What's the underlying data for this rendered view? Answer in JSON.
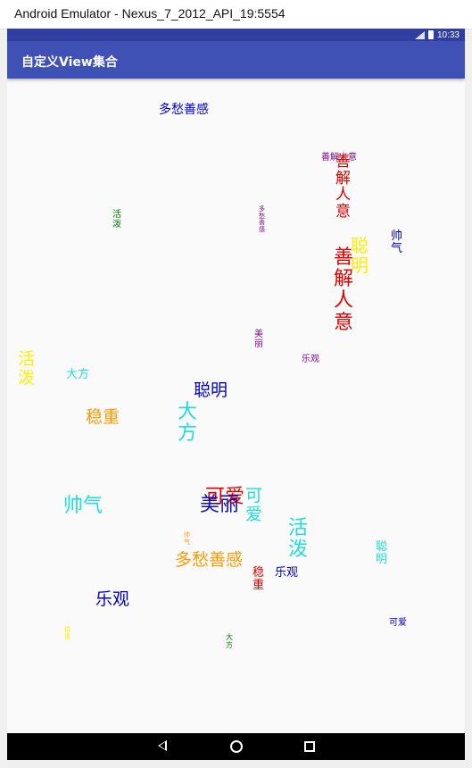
{
  "window": {
    "title": "Android Emulator - Nexus_7_2012_API_19:5554"
  },
  "statusbar": {
    "time": "10:33",
    "battery_icon": "battery-icon",
    "signal_icon": "signal-icon"
  },
  "appbar": {
    "title": "自定义View集合"
  },
  "navbar": {
    "back_icon": "back-triangle-icon",
    "home_icon": "home-circle-icon",
    "recent_icon": "recents-square-icon"
  },
  "words": [
    {
      "text": "多愁善感",
      "color": "#0000cc"
    },
    {
      "text": "善解人意",
      "color": "#7b0a8a"
    },
    {
      "text": "善解人意",
      "color": "#e00000"
    },
    {
      "text": "活泼",
      "color": "#007700"
    },
    {
      "text": "多愁善感",
      "color": "#7b0a8a"
    },
    {
      "text": "帅气",
      "color": "#0000cc"
    },
    {
      "text": "聪明",
      "color": "#ffee00"
    },
    {
      "text": "善解人意",
      "color": "#e00000"
    },
    {
      "text": "美丽",
      "color": "#7b0a8a"
    },
    {
      "text": "乐观",
      "color": "#7b0a8a"
    },
    {
      "text": "活泼",
      "color": "#ffee00"
    },
    {
      "text": "大方",
      "color": "#22dddd"
    },
    {
      "text": "聪明",
      "color": "#0000cc"
    },
    {
      "text": "稳重",
      "color": "#ff9900"
    },
    {
      "text": "大方",
      "color": "#22dddd"
    },
    {
      "text": "帅气",
      "color": "#22dddd"
    },
    {
      "text": "可爱",
      "color": "#e00000"
    },
    {
      "text": "美丽",
      "color": "#1111aa"
    },
    {
      "text": "可爱",
      "color": "#22dddd"
    },
    {
      "text": "活泼",
      "color": "#22dddd"
    },
    {
      "text": "帅气",
      "color": "#ff9900"
    },
    {
      "text": "多愁善感",
      "color": "#ff9900"
    },
    {
      "text": "稳重",
      "color": "#e00000"
    },
    {
      "text": "乐观",
      "color": "#0000cc"
    },
    {
      "text": "聪明",
      "color": "#22dddd"
    },
    {
      "text": "乐观",
      "color": "#0000cc"
    },
    {
      "text": "稳重",
      "color": "#ffee00"
    },
    {
      "text": "大方",
      "color": "#007700"
    },
    {
      "text": "可爱",
      "color": "#0000cc"
    }
  ]
}
